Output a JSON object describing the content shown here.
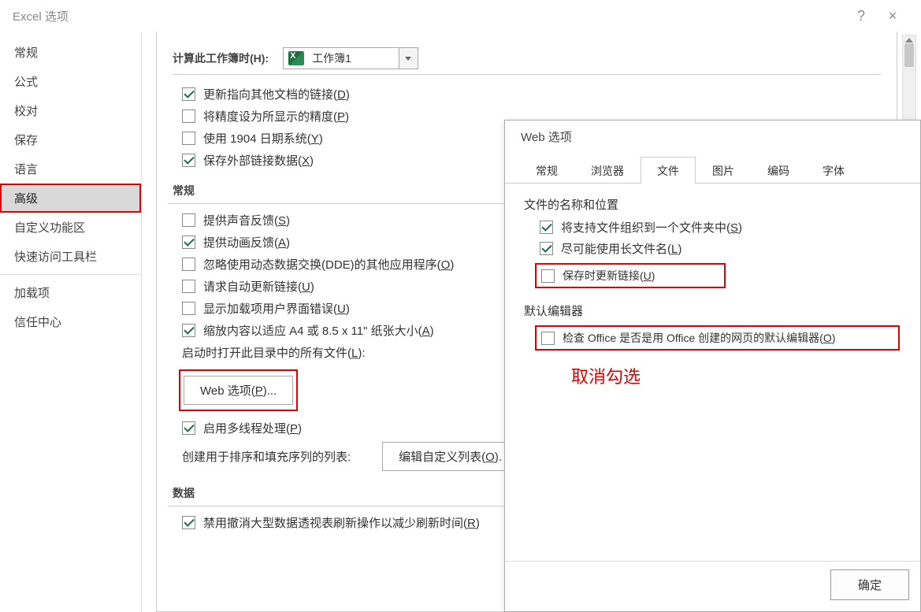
{
  "window": {
    "title": "Excel 选项",
    "help_tooltip": "?",
    "close_tooltip": "×"
  },
  "sidebar": {
    "items": [
      {
        "label": "常规"
      },
      {
        "label": "公式"
      },
      {
        "label": "校对"
      },
      {
        "label": "保存"
      },
      {
        "label": "语言"
      },
      {
        "label": "高级",
        "selected": true,
        "highlight": true
      },
      {
        "label": "自定义功能区"
      },
      {
        "label": "快速访问工具栏"
      },
      {
        "label": "加载项"
      },
      {
        "label": "信任中心"
      }
    ],
    "divider_after": 7
  },
  "content": {
    "calc_section_label": "计算此工作簿时(H):",
    "workbook_name": "工作簿1",
    "checks1": [
      {
        "label_pre": "更新指向其他文档的链接(",
        "mnemonic": "D",
        "label_post": ")",
        "checked": true
      },
      {
        "label_pre": "将精度设为所显示的精度(",
        "mnemonic": "P",
        "label_post": ")",
        "checked": false
      },
      {
        "label_pre": "使用 1904 日期系统(",
        "mnemonic": "Y",
        "label_post": ")",
        "checked": false
      },
      {
        "label_pre": "保存外部链接数据(",
        "mnemonic": "X",
        "label_post": ")",
        "checked": true
      }
    ],
    "general_label": "常规",
    "checks2": [
      {
        "label_pre": "提供声音反馈(",
        "mnemonic": "S",
        "label_post": ")",
        "checked": false
      },
      {
        "label_pre": "提供动画反馈(",
        "mnemonic": "A",
        "label_post": ")",
        "checked": true
      },
      {
        "label_pre": "忽略使用动态数据交换(DDE)的其他应用程序(",
        "mnemonic": "O",
        "label_post": ")",
        "checked": false
      },
      {
        "label_pre": "请求自动更新链接(",
        "mnemonic": "U",
        "label_post": ")",
        "checked": false
      },
      {
        "label_pre": "显示加载项用户界面错误(",
        "mnemonic": "U",
        "label_post": ")",
        "checked": false
      },
      {
        "label_pre": "缩放内容以适应 A4 或 8.5 x 11\" 纸张大小(",
        "mnemonic": "A",
        "label_post": ")",
        "checked": true
      }
    ],
    "startup_label_pre": "启动时打开此目录中的所有文件(",
    "startup_mnemonic": "L",
    "startup_label_post": "):",
    "web_options_btn_pre": "Web 选项(",
    "web_options_mnemonic": "P",
    "web_options_btn_post": ")...",
    "checks3": [
      {
        "label_pre": "启用多线程处理(",
        "mnemonic": "P",
        "label_post": ")",
        "checked": true
      }
    ],
    "sort_label": "创建用于排序和填充序列的列表:",
    "sort_btn_pre": "编辑自定义列表(",
    "sort_mnemonic": "O",
    "sort_btn_post": ").",
    "data_label": "数据",
    "checks4": [
      {
        "label_pre": "禁用撤消大型数据透视表刷新操作以减少刷新时间(",
        "mnemonic": "R",
        "label_post": ")",
        "checked": true
      }
    ]
  },
  "dialog": {
    "title": "Web 选项",
    "tabs": [
      {
        "label": "常规"
      },
      {
        "label": "浏览器"
      },
      {
        "label": "文件",
        "active": true
      },
      {
        "label": "图片"
      },
      {
        "label": "编码"
      },
      {
        "label": "字体"
      }
    ],
    "group1_title": "文件的名称和位置",
    "group1_checks": [
      {
        "label_pre": "将支持文件组织到一个文件夹中(",
        "mnemonic": "S",
        "label_post": ")",
        "checked": true
      },
      {
        "label_pre": "尽可能使用长文件名(",
        "mnemonic": "L",
        "label_post": ")",
        "checked": true
      }
    ],
    "group1_redcheck": {
      "label_pre": "保存时更新链接(",
      "mnemonic": "U",
      "label_post": ")",
      "checked": false
    },
    "group2_title": "默认编辑器",
    "group2_redcheck": {
      "label_pre": "检查 Office 是否是用 Office 创建的网页的默认编辑器(",
      "mnemonic": "O",
      "label_post": ")",
      "checked": false
    },
    "annotation": "取消勾选",
    "ok_label": "确定"
  }
}
